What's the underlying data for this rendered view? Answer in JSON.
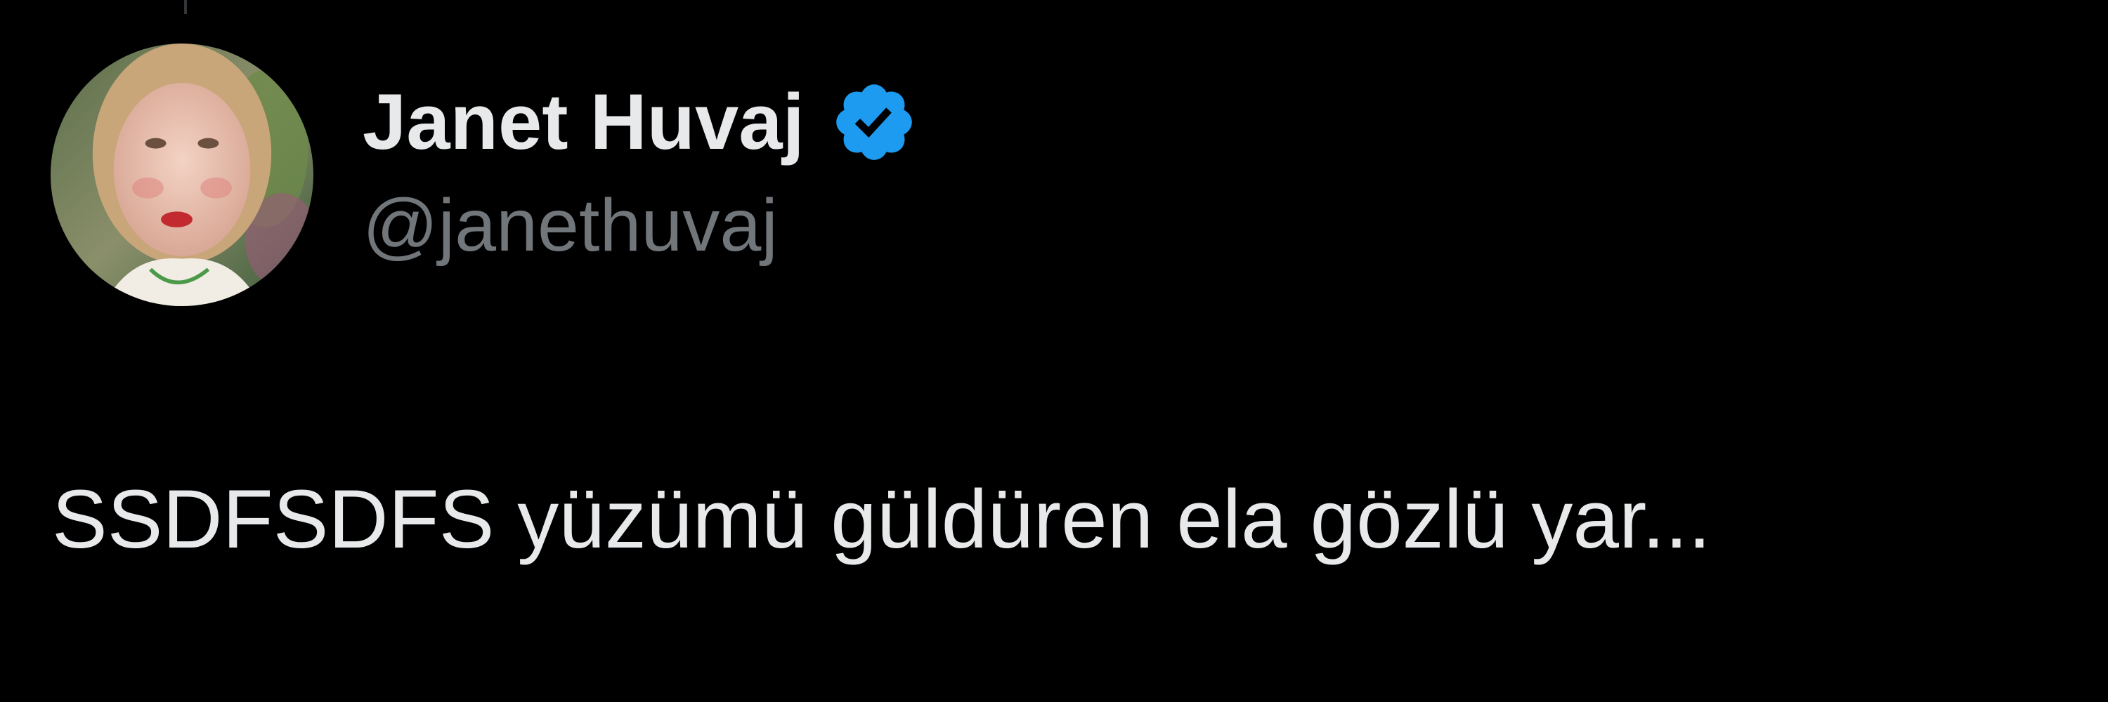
{
  "tweet": {
    "author": {
      "display_name": "Janet Huvaj",
      "handle": "@janethuvaj",
      "verified": true,
      "avatar_icon": "profile-photo"
    },
    "text": "SSDFSDFS yüzümü güldüren ela gözlü yar..."
  },
  "theme": {
    "background": "#000000",
    "primary_text": "#e7e9ea",
    "secondary_text": "#71767b",
    "verified_blue": "#1d9bf0"
  }
}
